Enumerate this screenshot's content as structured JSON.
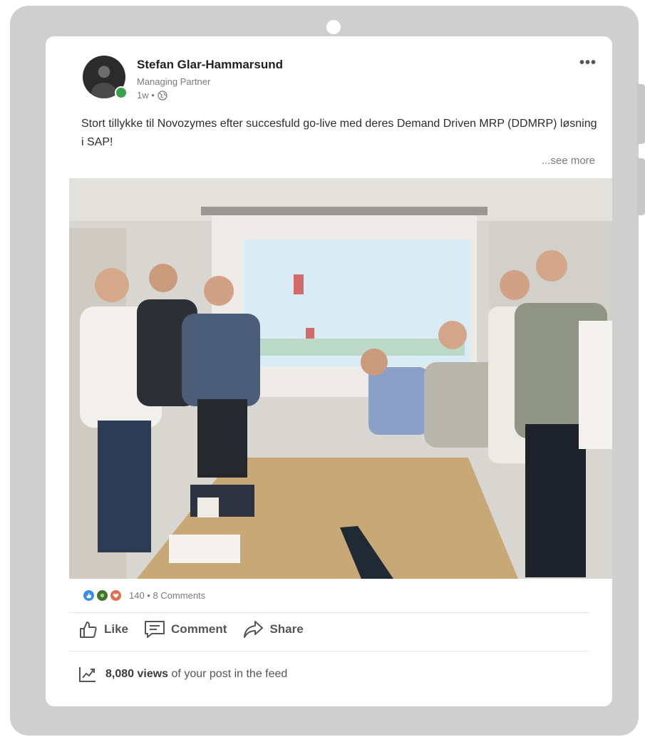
{
  "post": {
    "author_name": "Stefan Glar-Hammarsund",
    "author_title": "Managing Partner",
    "time_ago": "1w •",
    "more_menu": "•••",
    "text": "Stort tillykke til Novozymes efter succesfuld go-live med deres Demand Driven MRP (DDMRP) løsning i SAP!",
    "see_more": "...see more"
  },
  "engagement": {
    "reaction_icons": [
      "like-icon",
      "celebrate-icon",
      "love-icon"
    ],
    "reaction_colors": [
      "#378fe9",
      "#44712e",
      "#df704d"
    ],
    "count_text": "140 • 8 Comments"
  },
  "actions": {
    "like_label": "Like",
    "comment_label": "Comment",
    "share_label": "Share"
  },
  "analytics": {
    "views_count": "8,080 views",
    "views_suffix": "of your post in the feed"
  }
}
